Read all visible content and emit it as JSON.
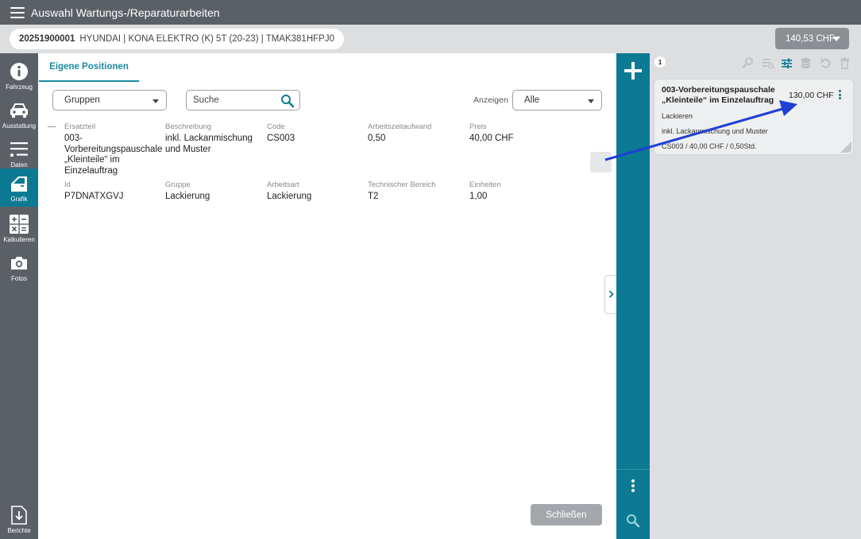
{
  "header": {
    "title": "Auswahl Wartungs-/Reparaturarbeiten"
  },
  "vehicle": {
    "claim_number": "20251900001",
    "description": "HYUNDAI | KONA ELEKTRO (K) 5T (20-23) | TMAK381HFPJ0"
  },
  "total": {
    "amount": "140,53 CHF"
  },
  "sidebar": {
    "items": [
      {
        "label": "Fahrzeug",
        "icon": "info-icon"
      },
      {
        "label": "Ausstattung",
        "icon": "car-icon"
      },
      {
        "label": "Daten",
        "icon": "list-icon"
      },
      {
        "label": "Grafik",
        "icon": "door-icon",
        "active": true
      },
      {
        "label": "Kalkulieren",
        "icon": "calculator-icon"
      },
      {
        "label": "Fotos",
        "icon": "camera-icon"
      }
    ],
    "bottom": {
      "label": "Berichte",
      "icon": "download-icon"
    }
  },
  "tabs": [
    {
      "label": "Eigene Positionen",
      "active": true
    }
  ],
  "filters": {
    "group_select": "Gruppen",
    "search_placeholder": "Suche",
    "show_label": "Anzeigen",
    "show_select": "Alle"
  },
  "position": {
    "row1": [
      {
        "header": "Ersatzteil",
        "value": "003-\nVorbereitungspauschale\n„Kleinteile“ im\nEinzelauftrag"
      },
      {
        "header": "Beschreibung",
        "value": "inkl. Lackanmischung\nund Muster"
      },
      {
        "header": "Code",
        "value": "CS003"
      },
      {
        "header": "Arbeitszeitaufwand",
        "value": "0,50"
      },
      {
        "header": "Preis",
        "value": "40,00 CHF"
      }
    ],
    "row2": [
      {
        "header": "Id",
        "value": "P7DNATXGVJ"
      },
      {
        "header": "Gruppe",
        "value": "Lackierung"
      },
      {
        "header": "Arbeitsart",
        "value": "Lackierung"
      },
      {
        "header": "Technischer Bereich",
        "value": "T2"
      },
      {
        "header": "Einheiten",
        "value": "1,00"
      }
    ]
  },
  "close_button": {
    "label": "Schließen"
  },
  "right_panel": {
    "count": "1",
    "card": {
      "title": "003-Vorbereitungspauschale „Kleinteile“ im Einzelauftrag",
      "price": "130,00 CHF",
      "work_type": "Lackieren",
      "description": "inkl. Lackanmischung und Muster",
      "details": "CS003 / 40,00 CHF / 0,50Std."
    }
  },
  "colors": {
    "teal": "#0b7a92",
    "sidebar": "#5b6066",
    "arrow": "#1f3fd6",
    "link": "#1a8aa5"
  }
}
